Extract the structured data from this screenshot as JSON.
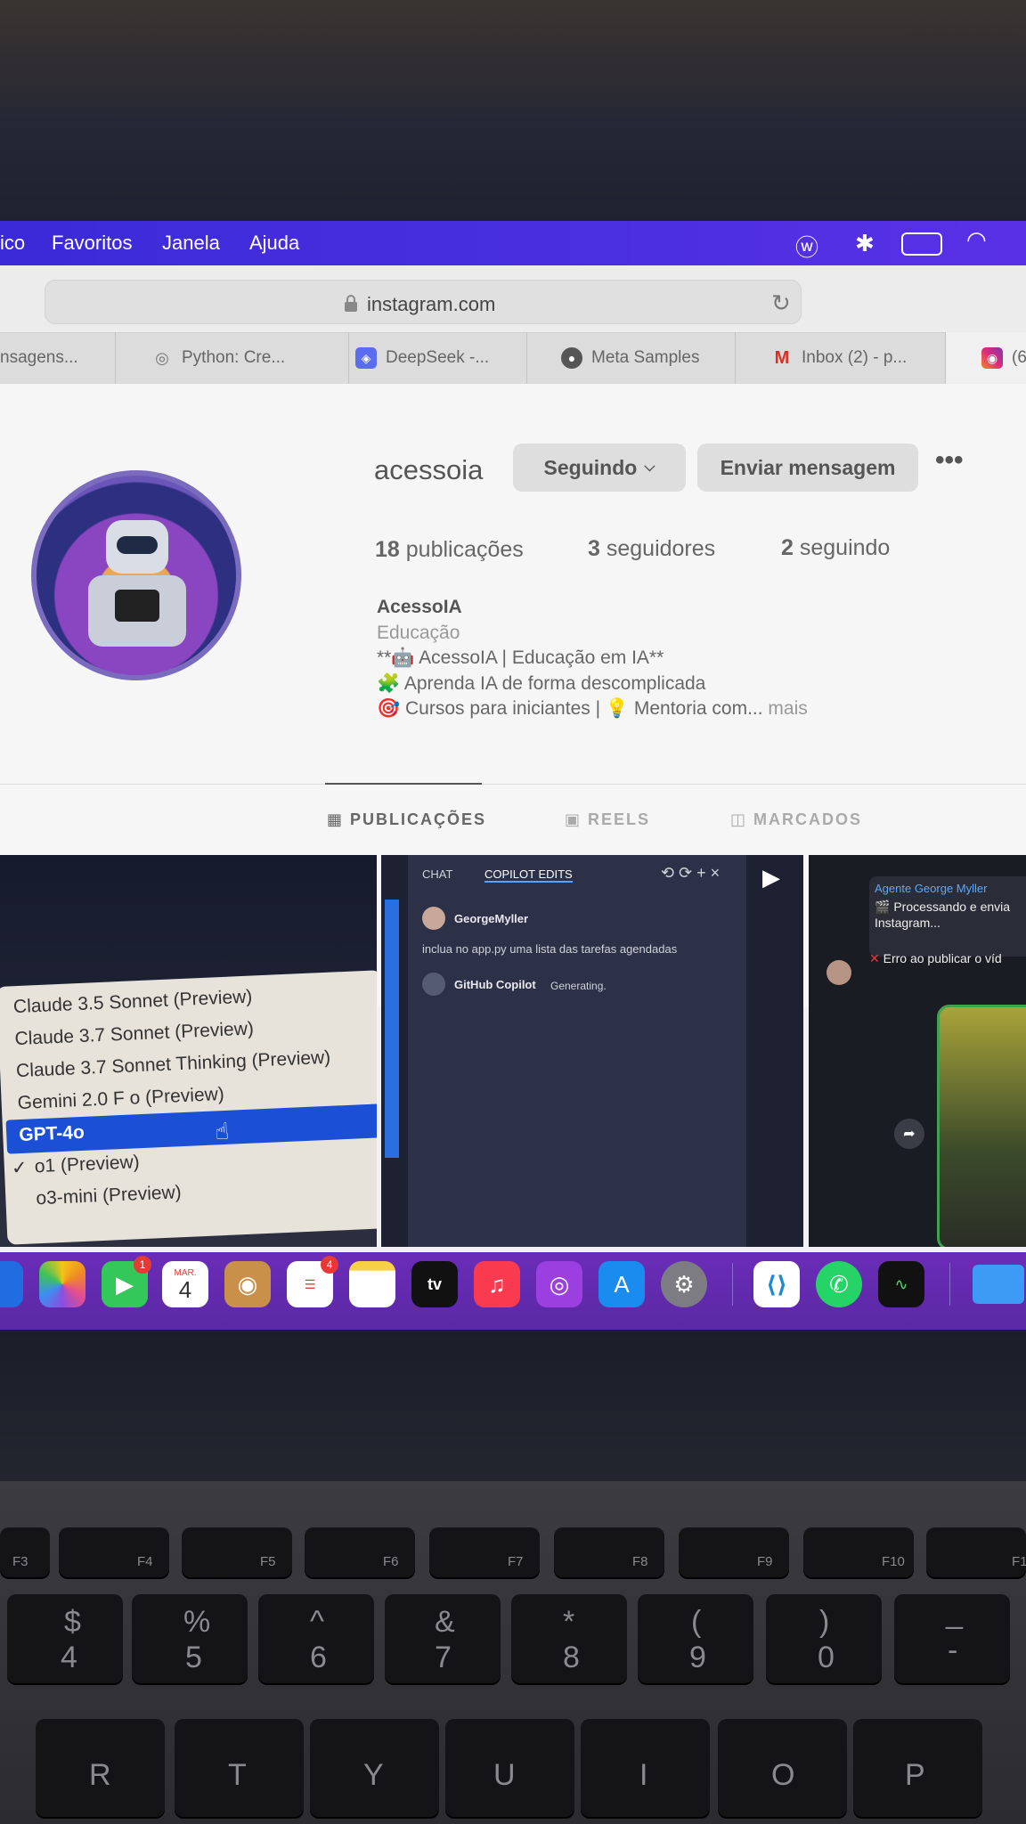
{
  "menubar": {
    "items": [
      "ico",
      "Favoritos",
      "Janela",
      "Ajuda"
    ]
  },
  "browser": {
    "url": "instagram.com",
    "tabs": [
      {
        "label": "nsagens...",
        "icon": "none"
      },
      {
        "label": "Python: Cre...",
        "icon": "podcast-icon"
      },
      {
        "label": "DeepSeek -...",
        "icon": "deepseek-icon"
      },
      {
        "label": "Meta Samples",
        "icon": "github-icon"
      },
      {
        "label": "Inbox (2) - p...",
        "icon": "gmail-icon"
      },
      {
        "label": "(6",
        "icon": "instagram-icon"
      }
    ]
  },
  "profile": {
    "username": "acessoia",
    "following_button": "Seguindo",
    "message_button": "Enviar mensagem",
    "stats": {
      "posts_count": "18",
      "posts_label": "publicações",
      "followers_count": "3",
      "followers_label": "seguidores",
      "following_count": "2",
      "following_label": "seguindo"
    },
    "bio": {
      "name": "AcessoIA",
      "category": "Educação",
      "line1": "**🤖 AcessoIA | Educação em IA**",
      "line2": "🧩 Aprenda IA de forma descomplicada",
      "line3": "🎯 Cursos para iniciantes | 💡 Mentoria com...",
      "more": "mais"
    }
  },
  "profile_tabs": [
    "PUBLICAÇÕES",
    "REELS",
    "MARCADOS"
  ],
  "posts": {
    "model_menu": {
      "items": [
        "Claude 3.5 Sonnet (Preview)",
        "Claude 3.7 Sonnet (Preview)",
        "Claude 3.7 Sonnet Thinking (Preview)",
        "Gemini 2.0 F   o (Preview)",
        "GPT-4o",
        "o1 (Preview)",
        "o3-mini (Preview)"
      ],
      "selected": "GPT-4o",
      "checked": "o1 (Preview)"
    },
    "copilot": {
      "tab_chat": "CHAT",
      "tab_edits": "COPILOT EDITS",
      "user": "GeorgeMyller",
      "prompt": "inclua no app.py uma lista das tarefas agendadas",
      "assistant": "GitHub Copilot",
      "status": "Generating."
    },
    "agent": {
      "title": "Agente George Myller",
      "processing": "🎬 Processando e envia",
      "processing2": "Instagram...",
      "error": "Erro ao publicar o víd"
    }
  },
  "dock": {
    "calendar_month": "MAR.",
    "calendar_day": "4",
    "facetime_badge": "1",
    "reminders_badge": "4",
    "appletv_label": "tv"
  },
  "keyboard": {
    "fkeys": [
      "F3",
      "F4",
      "F5",
      "F6",
      "F7",
      "F8",
      "F9",
      "F10",
      "F1"
    ],
    "number_keys": [
      {
        "top": "$",
        "bottom": "4"
      },
      {
        "top": "%",
        "bottom": "5"
      },
      {
        "top": "^",
        "bottom": "6"
      },
      {
        "top": "&",
        "bottom": "7"
      },
      {
        "top": "*",
        "bottom": "8"
      },
      {
        "top": "(",
        "bottom": "9"
      },
      {
        "top": ")",
        "bottom": "0"
      },
      {
        "top": "_",
        "bottom": "-"
      }
    ],
    "letter_keys": [
      "R",
      "T",
      "Y",
      "U",
      "I",
      "O",
      "P"
    ]
  }
}
